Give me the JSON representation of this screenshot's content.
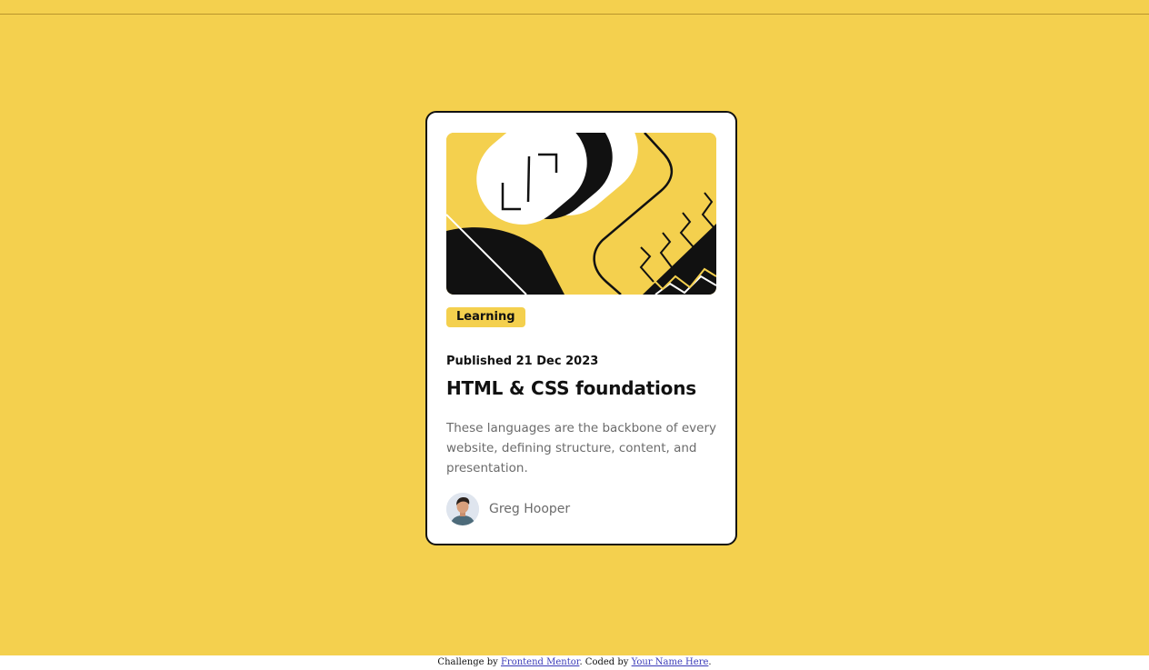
{
  "colors": {
    "page_background": "#f4d04e",
    "card_background": "#ffffff",
    "card_border": "#111111",
    "text_primary": "#111111",
    "text_secondary": "#6b6b6b",
    "link": "#3b3bb8"
  },
  "card": {
    "illustration_icon": "abstract-illustration",
    "tag": "Learning",
    "published": "Published 21 Dec 2023",
    "title": "HTML & CSS foundations",
    "description": "These languages are the backbone of every website, defining structure, content, and presentation.",
    "author": {
      "avatar_icon": "avatar-photo",
      "name": "Greg Hooper"
    }
  },
  "footer": {
    "prefix": "Challenge by ",
    "challenge_link": "Frontend Mentor",
    "middle": ". Coded by ",
    "author_link": "Your Name Here",
    "suffix": "."
  }
}
